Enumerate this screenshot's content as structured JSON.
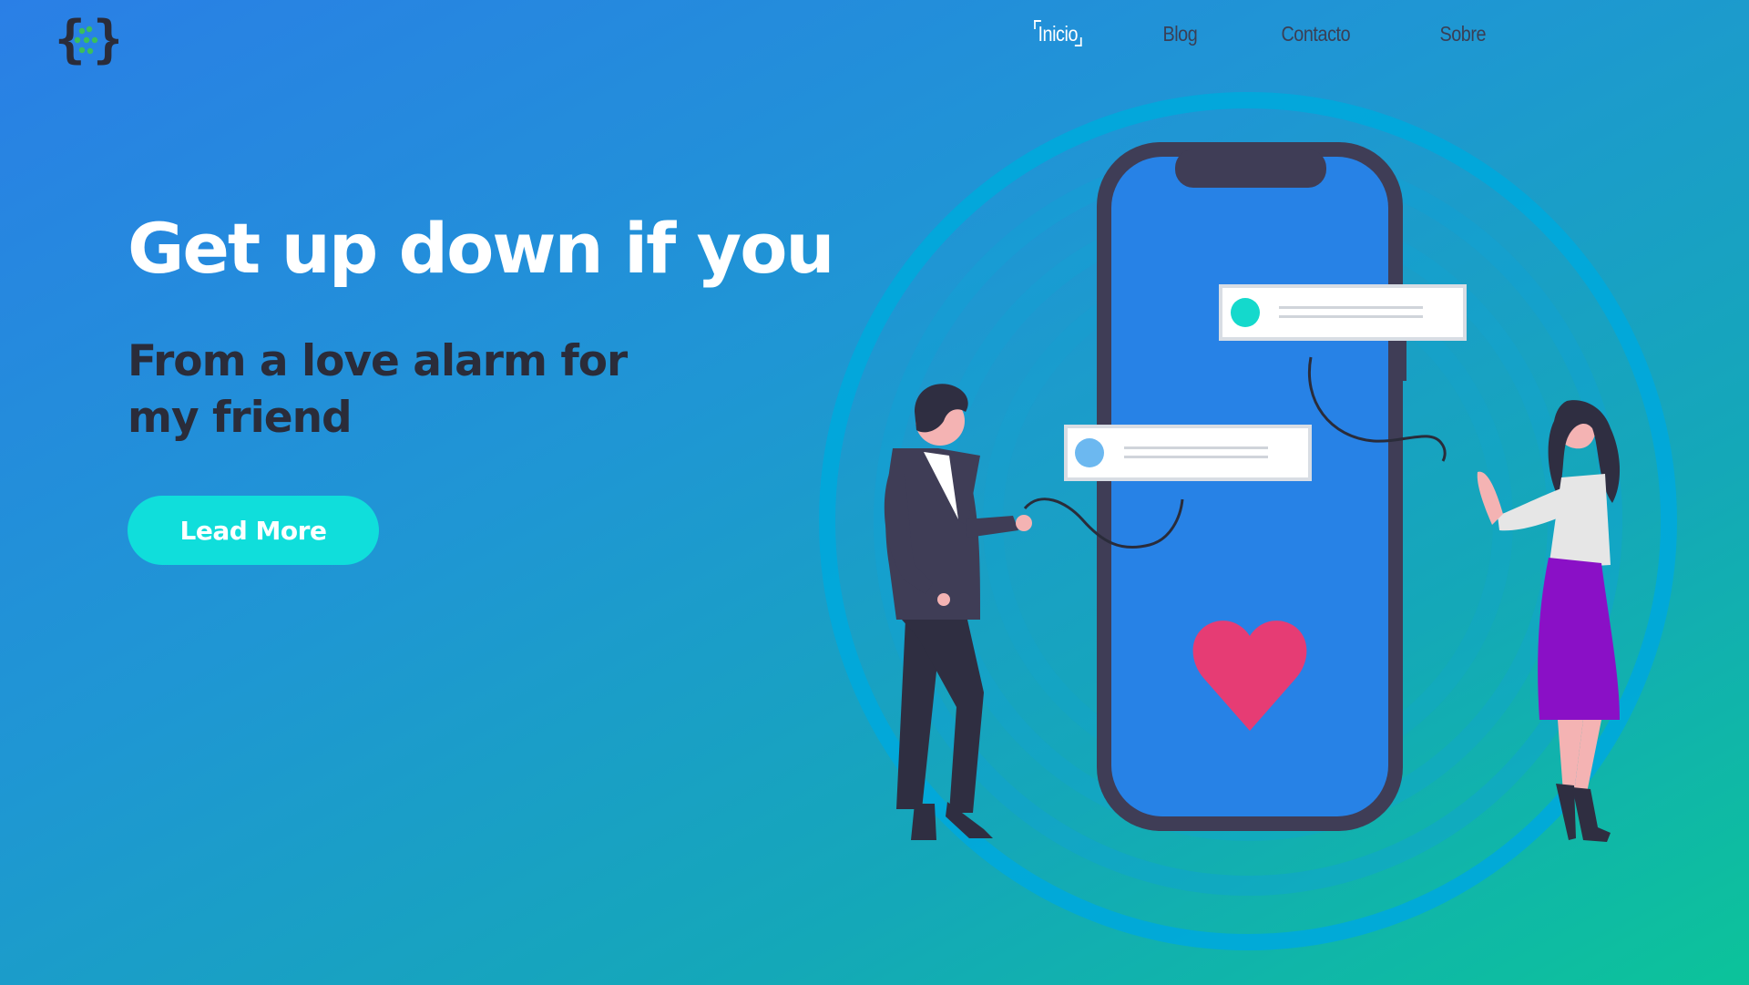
{
  "logo": {
    "icon": "curly-braces-dots-logo",
    "accent": "#3bbf5a"
  },
  "nav": {
    "items": [
      {
        "label": "Inicio",
        "active": true
      },
      {
        "label": "Blog",
        "active": false
      },
      {
        "label": "Contacto",
        "active": false
      },
      {
        "label": "Sobre",
        "active": false
      }
    ]
  },
  "hero": {
    "title": "Get up down if you",
    "subtitle": "From a love alarm for my friend",
    "cta_label": "Lead More"
  },
  "illustration": {
    "icon": "love-alarm-phone-couple",
    "heart_color": "#e63c74",
    "phone_frame_color": "#3f3d56",
    "phone_screen_color": "#2782e6",
    "ring_color": "#00a8dc",
    "cta_color": "#10dedb",
    "skirt_color": "#8a10c6"
  }
}
